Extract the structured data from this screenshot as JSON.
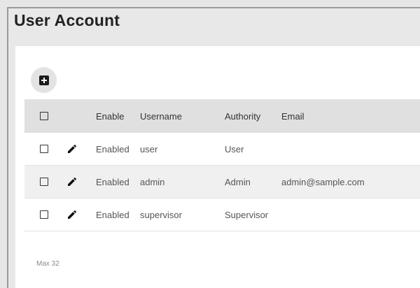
{
  "page": {
    "title": "User Account"
  },
  "toolbar": {
    "add_icon": "plus-square-icon"
  },
  "table": {
    "columns": {
      "enable": "Enable",
      "username": "Username",
      "authority": "Authority",
      "email": "Email"
    },
    "rows": [
      {
        "enable": "Enabled",
        "username": "user",
        "authority": "User",
        "email": ""
      },
      {
        "enable": "Enabled",
        "username": "admin",
        "authority": "Admin",
        "email": "admin@sample.com"
      },
      {
        "enable": "Enabled",
        "username": "supervisor",
        "authority": "Supervisor",
        "email": ""
      }
    ]
  },
  "footer": {
    "max_text": "Max 32"
  }
}
